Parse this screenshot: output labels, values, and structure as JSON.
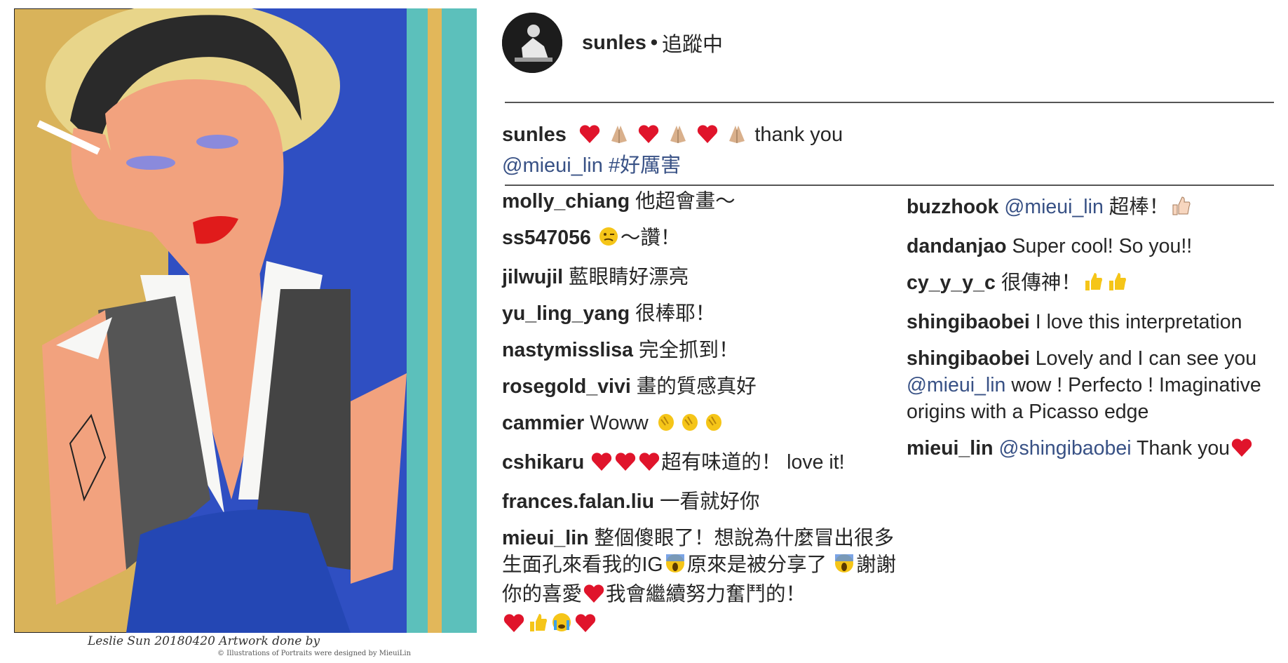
{
  "artwork": {
    "signature": "Leslie Sun 20180420  Artwork done by",
    "copyright": "© Illustrations of Portraits were designed by MieuiLin"
  },
  "header": {
    "username": "sunles",
    "separator": "•",
    "follow_status": "追蹤中"
  },
  "caption": {
    "username": "sunles",
    "emojis": [
      "heart",
      "pray",
      "heart",
      "pray",
      "heart",
      "pray"
    ],
    "text": "thank you",
    "mention": "@mieui_lin",
    "hashtag": "#好厲害"
  },
  "comments_left": [
    {
      "user": "molly_chiang",
      "text": "他超會畫～"
    },
    {
      "user": "ss547056",
      "emoji_before": [
        "wink"
      ],
      "text": "～讚！"
    },
    {
      "user": "jilwujil",
      "text": "藍眼睛好漂亮"
    },
    {
      "user": "yu_ling_yang",
      "text": "很棒耶！"
    },
    {
      "user": "nastymisslisa",
      "text": "完全抓到！"
    },
    {
      "user": "rosegold_vivi",
      "text": "畫的質感真好"
    },
    {
      "user": "cammier",
      "text": "Woww",
      "emoji_after": [
        "clap",
        "clap",
        "clap"
      ]
    },
    {
      "user": "cshikaru",
      "emoji_before": [
        "heart",
        "heart",
        "heart"
      ],
      "text": "超有味道的！ love it!"
    },
    {
      "user": "frances.falan.liu",
      "text": "一看就好你"
    },
    {
      "user": "mieui_lin",
      "text": "整個傻眼了！想說為什麼冒出很多生面孔來看我的IG",
      "text2": "原來是被分享了",
      "text3": "謝謝你的喜愛",
      "text4": "我會繼續努力奮鬥的！"
    }
  ],
  "comments_right": [
    {
      "user": "buzzhook",
      "mention": "@mieui_lin",
      "text": "超棒！",
      "emoji_after": [
        "thumbs-up"
      ]
    },
    {
      "user": "dandanjao",
      "text": "Super cool! So you!!"
    },
    {
      "user": "cy_y_y_c",
      "text": "很傳神！",
      "emoji_after": [
        "thumbs-up",
        "thumbs-up"
      ]
    },
    {
      "user": "shingibaobei",
      "text": "I love this interpretation"
    },
    {
      "user": "shingibaobei",
      "text": "Lovely and I can see you",
      "mention": "@mieui_lin",
      "text2": "wow ! Perfecto ! Imaginative origins with a Picasso edge"
    },
    {
      "user": "mieui_lin",
      "mention": "@shingibaobei",
      "text": "Thank you",
      "emoji_after": [
        "heart"
      ]
    }
  ],
  "colors": {
    "link": "#385185",
    "heart": "#e0142b",
    "hands": "#d9b08c",
    "clap": "#f5c518",
    "divider": "#555555"
  }
}
